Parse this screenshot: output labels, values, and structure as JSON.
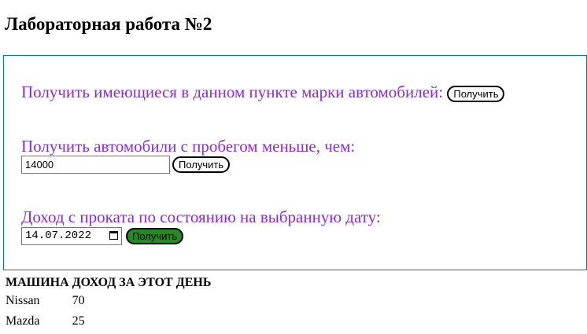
{
  "title": "Лабораторная работа №2",
  "section1": {
    "label": "Получить имеющиеся в данном пункте марки автомобилей:",
    "button": "Получить"
  },
  "section2": {
    "label": "Получить автомобили с пробегом меньше, чем:",
    "input_value": "14000",
    "button": "Получить"
  },
  "section3": {
    "label": "Доход с проката по состоянию на выбранную дату:",
    "date_value": "14.07.2022",
    "button": "Получить",
    "button_color": "#228b22"
  },
  "table": {
    "headers": [
      "МАШИНА",
      "ДОХОД ЗА ЭТОТ ДЕНЬ"
    ],
    "rows": [
      [
        "Nissan",
        "70"
      ],
      [
        "Mazda",
        "25"
      ]
    ]
  },
  "colors": {
    "label": "#8a2be2",
    "border": "#008080"
  }
}
